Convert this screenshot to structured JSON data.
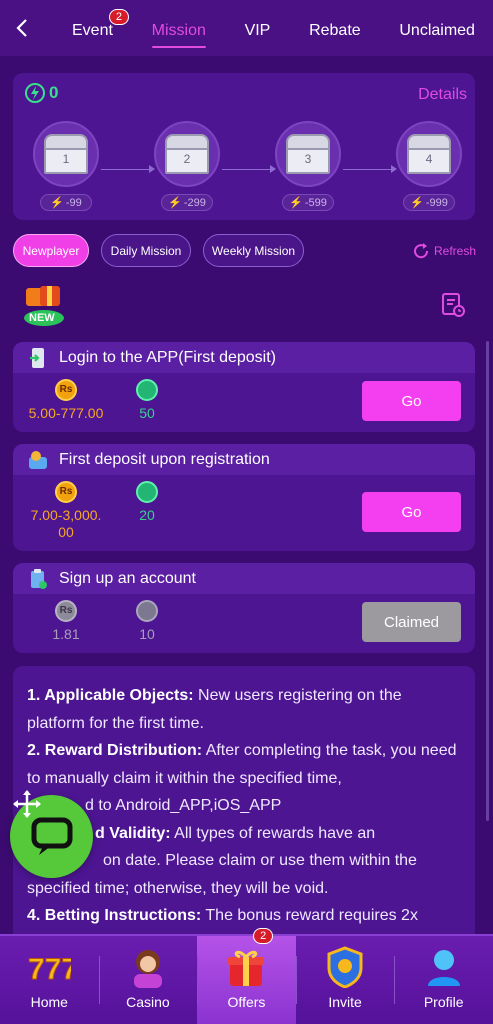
{
  "nav": {
    "tabs": [
      {
        "label": "Event",
        "badge": "2"
      },
      {
        "label": "Mission"
      },
      {
        "label": "VIP"
      },
      {
        "label": "Rebate"
      },
      {
        "label": "Unclaimed"
      }
    ],
    "active_tab": "Mission"
  },
  "chest_panel": {
    "points": "0",
    "details_label": "Details",
    "chests": [
      {
        "number": "1",
        "cost": "-99"
      },
      {
        "number": "2",
        "cost": "-299"
      },
      {
        "number": "3",
        "cost": "-599"
      },
      {
        "number": "4",
        "cost": "-999"
      }
    ]
  },
  "filters": {
    "pills": [
      "Newplayer",
      "Daily Mission",
      "Weekly Mission"
    ],
    "active": "Newplayer",
    "refresh_label": "Refresh"
  },
  "new_badge_text": "NEW",
  "tasks": [
    {
      "title": "Login to the APP(First deposit)",
      "coin_amount": "5.00-777.00",
      "points": "50",
      "button": "Go",
      "coin_symbol": "Rs"
    },
    {
      "title": "First deposit upon registration",
      "coin_amount_line1": "7.00-3,000.",
      "coin_amount_line2": "00",
      "points": "20",
      "button": "Go",
      "coin_symbol": "Rs"
    },
    {
      "title": "Sign up an account",
      "coin_amount": "1.81",
      "points": "10",
      "button": "Claimed",
      "coin_symbol": "Rs"
    }
  ],
  "rules": [
    {
      "head": "1. Applicable Objects:",
      "text": " New users registering on the platform for the first time."
    },
    {
      "head": "2. Reward Distribution:",
      "text": " After completing the task, you need to manually claim it within the specified time,"
    },
    {
      "head": "",
      "text": "d to Android_APP,iOS_APP"
    },
    {
      "head": "d Validity:",
      "text": " All types of rewards have an"
    },
    {
      "head": "",
      "text": "on date. Please claim or use them within the specified time; otherwise, they will be void."
    },
    {
      "head": "4. Betting Instructions:",
      "text": " The bonus reward requires 2x"
    }
  ],
  "bottom_nav": {
    "items": [
      {
        "label": "Home"
      },
      {
        "label": "Casino"
      },
      {
        "label": "Offers",
        "badge": "2"
      },
      {
        "label": "Invite"
      },
      {
        "label": "Profile"
      }
    ],
    "active": "Offers"
  },
  "colors": {
    "accent": "#e04be0",
    "go_button": "#f43ff0",
    "points_green": "#34d38b",
    "coin_gold": "#f6a823",
    "background": "#3c0b72"
  }
}
